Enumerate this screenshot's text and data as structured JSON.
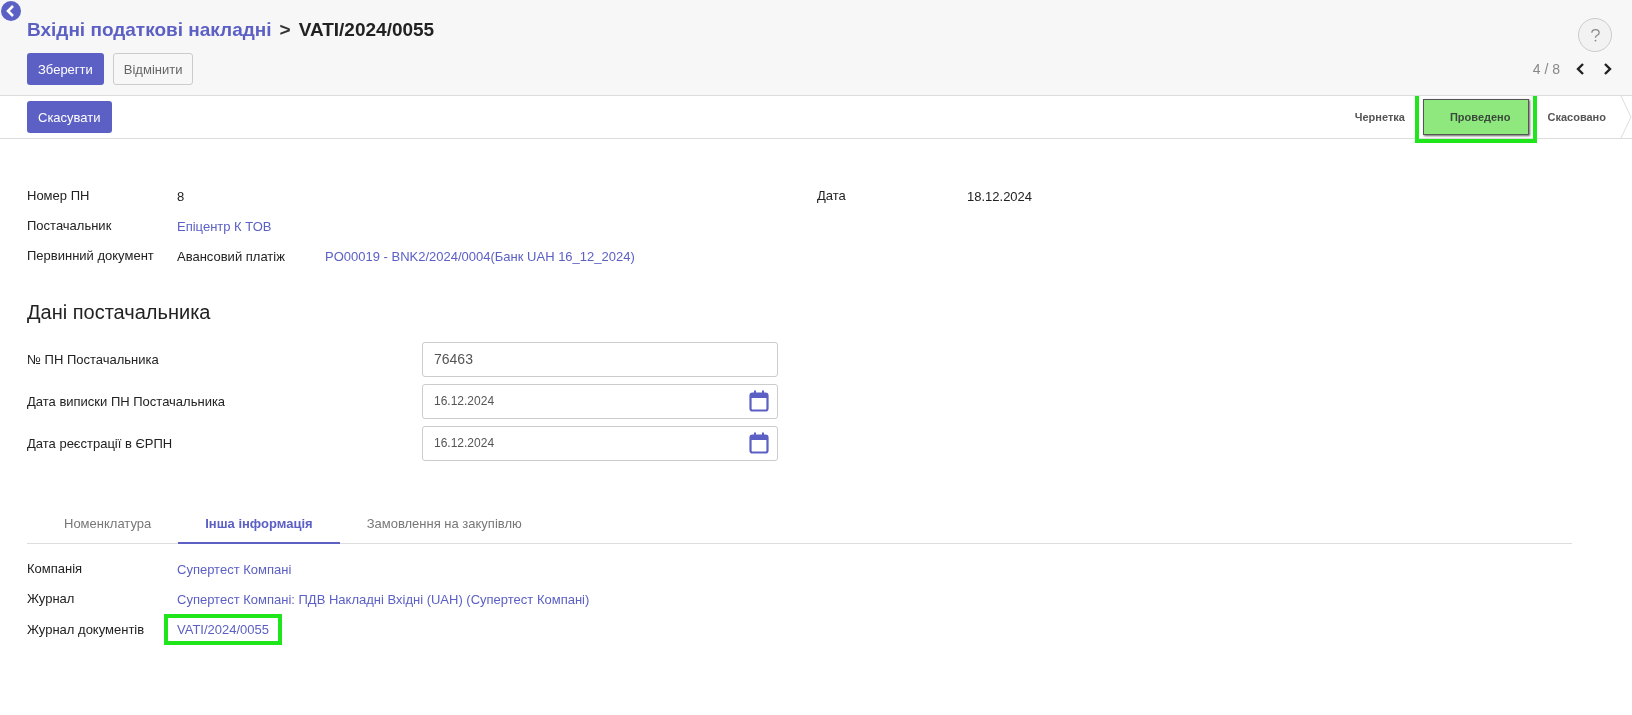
{
  "breadcrumb": {
    "parent": "Вхідні податкові накладні",
    "separator": ">",
    "current": "VATI/2024/0055"
  },
  "actions": [
    {
      "label": "Зберегти",
      "kind": "primary"
    },
    {
      "label": "Відмінити",
      "kind": "secondary"
    }
  ],
  "pager": {
    "value": "4 / 8"
  },
  "status_buttons": [
    {
      "label": "Скасувати"
    }
  ],
  "stages": [
    {
      "label": "Чернетка",
      "selected": false,
      "highlighted": false
    },
    {
      "label": "Проведено",
      "selected": true,
      "highlighted": true
    },
    {
      "label": "Скасовано",
      "selected": false,
      "highlighted": false
    }
  ],
  "header_fields": [
    {
      "label": "Номер ПН",
      "kind": "text",
      "value": "8"
    },
    {
      "label": "Постачальник",
      "kind": "link",
      "value": "Епіцентр К ТОВ"
    },
    {
      "label": "Первинний документ",
      "kind": "pair",
      "value": "Авансовий платіж",
      "link": "PO00019 - BNK2/2024/0004(Банк UAH 16_12_2024)"
    }
  ],
  "date_field": {
    "label": "Дата",
    "value": "18.12.2024"
  },
  "section_title": "Дані постачальника",
  "supplier_fields": [
    {
      "label": "№ ПН Постачальника",
      "kind": "text",
      "value": "76463"
    },
    {
      "label": "Дата виписки ПН Постачальника",
      "kind": "date",
      "value": "16.12.2024"
    },
    {
      "label": "Дата реєстрації в ЄРПН",
      "kind": "date",
      "value": "16.12.2024"
    }
  ],
  "tabs": [
    {
      "label": "Номенклатура",
      "selected": false
    },
    {
      "label": "Інша інформація",
      "selected": true
    },
    {
      "label": "Замовлення на закупівлю",
      "selected": false
    }
  ],
  "other_fields": [
    {
      "label": "Компанія",
      "value": "Супертест Компані",
      "highlighted": false
    },
    {
      "label": "Журнал",
      "value": "Супертест Компані: ПДВ Накладні Вхідні (UAH) (Супертест Компані)",
      "highlighted": false
    },
    {
      "label": "Журнал документів",
      "value": "VATI/2024/0055",
      "highlighted": true
    }
  ]
}
